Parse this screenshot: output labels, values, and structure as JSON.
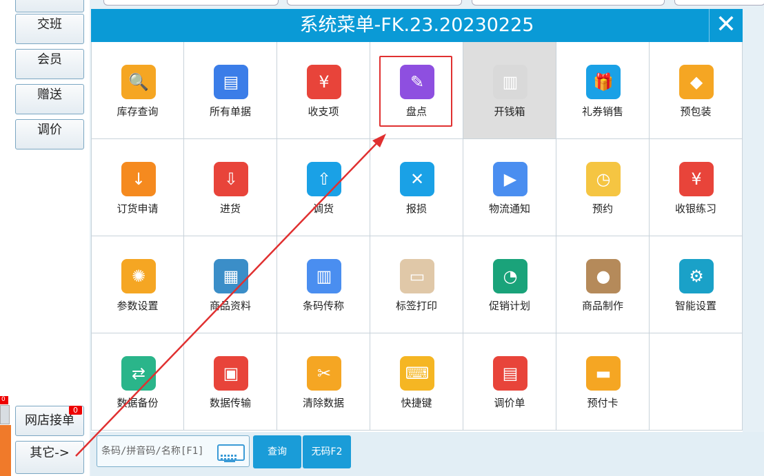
{
  "sidebar": {
    "buttons": [
      "交班",
      "会员",
      "赠送",
      "调价"
    ],
    "online_orders": {
      "label": "网店接单",
      "badge": "0"
    },
    "more": "其它->"
  },
  "left_badge": "0",
  "dialog": {
    "title": "系统菜单-FK.23.20230225",
    "close": "✕",
    "items": [
      {
        "label": "库存查询",
        "icon": "inventory-search-icon",
        "color": "#f5a623"
      },
      {
        "label": "所有单据",
        "icon": "documents-icon",
        "color": "#3b7de8"
      },
      {
        "label": "收支项",
        "icon": "cash-hand-icon",
        "color": "#e8443a"
      },
      {
        "label": "盘点",
        "icon": "clipboard-check-icon",
        "color": "#8e4fe0"
      },
      {
        "label": "开钱箱",
        "icon": "cash-drawer-icon",
        "color": "#d9d9d9"
      },
      {
        "label": "礼券销售",
        "icon": "gift-icon",
        "color": "#1aa1e6"
      },
      {
        "label": "预包装",
        "icon": "package-icon",
        "color": "#f5a623"
      },
      {
        "label": "订货申请",
        "icon": "order-request-icon",
        "color": "#f58a1f"
      },
      {
        "label": "进货",
        "icon": "stock-in-icon",
        "color": "#e8443a"
      },
      {
        "label": "调货",
        "icon": "transfer-icon",
        "color": "#1aa1e6"
      },
      {
        "label": "报损",
        "icon": "tools-icon",
        "color": "#1aa1e6"
      },
      {
        "label": "物流通知",
        "icon": "delivery-truck-icon",
        "color": "#4a8ef0"
      },
      {
        "label": "预约",
        "icon": "calendar-clock-icon",
        "color": "#f5c542"
      },
      {
        "label": "收银练习",
        "icon": "cash-practice-icon",
        "color": "#e8443a"
      },
      {
        "label": "参数设置",
        "icon": "gears-icon",
        "color": "#f5a623"
      },
      {
        "label": "商品资料",
        "icon": "product-info-icon",
        "color": "#3b8ec8"
      },
      {
        "label": "条码传称",
        "icon": "barcode-scale-icon",
        "color": "#4a8ef0"
      },
      {
        "label": "标签打印",
        "icon": "label-roll-icon",
        "color": "#e0c8a8"
      },
      {
        "label": "促销计划",
        "icon": "alarm-clock-icon",
        "color": "#1aa37a"
      },
      {
        "label": "商品制作",
        "icon": "food-bowl-icon",
        "color": "#b58a5a"
      },
      {
        "label": "智能设置",
        "icon": "settings-gear-icon",
        "color": "#1aa1c8"
      },
      {
        "label": "数据备份",
        "icon": "data-backup-icon",
        "color": "#2ab58a"
      },
      {
        "label": "数据传输",
        "icon": "data-transfer-icon",
        "color": "#e8443a"
      },
      {
        "label": "清除数据",
        "icon": "broom-icon",
        "color": "#f5a623"
      },
      {
        "label": "快捷键",
        "icon": "keyboard-icon",
        "color": "#f5b623"
      },
      {
        "label": "调价单",
        "icon": "price-sheet-icon",
        "color": "#e8443a"
      },
      {
        "label": "预付卡",
        "icon": "prepaid-card-icon",
        "color": "#f5a623"
      }
    ]
  },
  "bottom": {
    "search_placeholder": "条码/拼音码/名称[F1]",
    "query": "查询",
    "no_code": "无码F2"
  },
  "accent_color": "#0a9ad6",
  "annotation_color": "#e03030"
}
